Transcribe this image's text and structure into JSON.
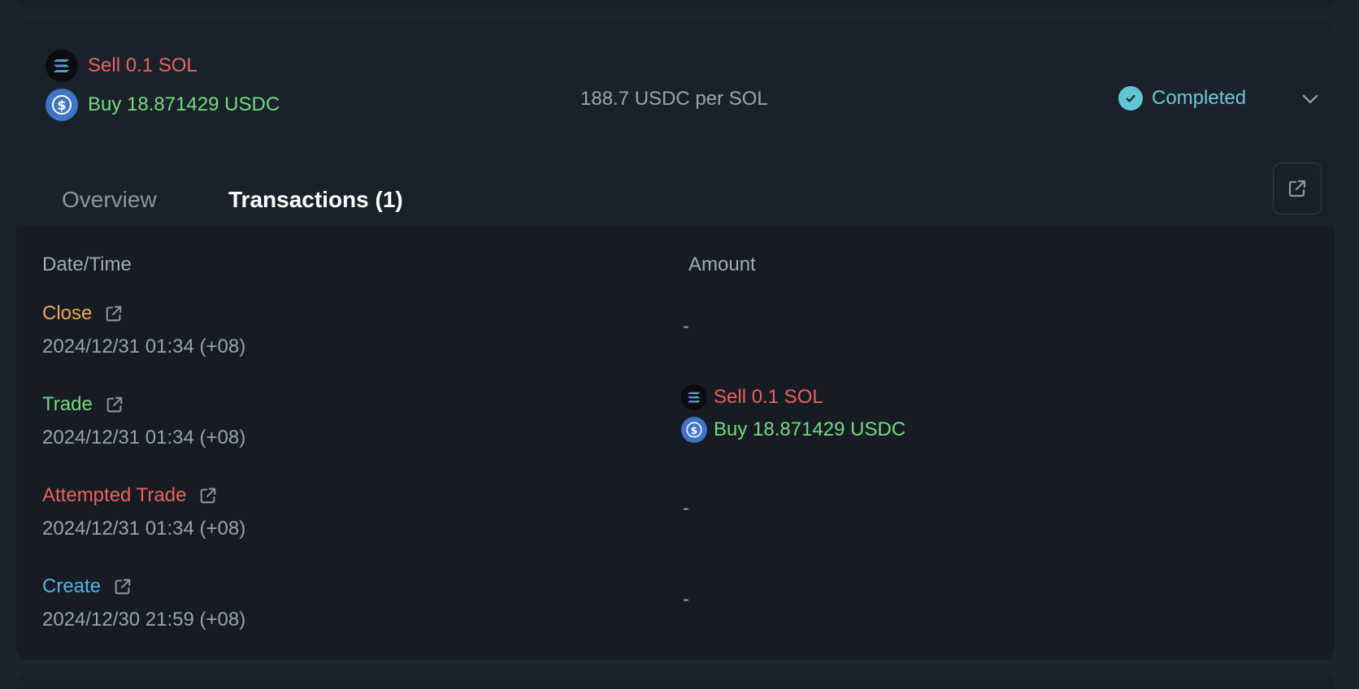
{
  "order": {
    "sell_label": "Sell 0.1 SOL",
    "buy_label": "Buy 18.871429 USDC",
    "rate": "188.7 USDC per SOL",
    "status": "Completed"
  },
  "tabs": [
    {
      "label": "Overview",
      "active": false
    },
    {
      "label": "Transactions (1)",
      "active": true
    }
  ],
  "table": {
    "headers": {
      "datetime": "Date/Time",
      "amount": "Amount"
    },
    "rows": [
      {
        "event": "Close",
        "event_color": "#f0a94e",
        "time": "2024/12/31 01:34 (+08)",
        "amount": "-"
      },
      {
        "event": "Trade",
        "event_color": "#72dc7e",
        "time": "2024/12/31 01:34 (+08)",
        "amount_sell": "Sell 0.1 SOL",
        "amount_buy": "Buy 18.871429 USDC"
      },
      {
        "event": "Attempted Trade",
        "event_color": "#e8625f",
        "time": "2024/12/31 01:34 (+08)",
        "amount": "-"
      },
      {
        "event": "Create",
        "event_color": "#4fb6e6",
        "time": "2024/12/30 21:59 (+08)",
        "amount": "-"
      }
    ]
  },
  "colors": {
    "sell": "#e8625f",
    "buy": "#72dc7e",
    "status": "#67c9d6",
    "tab_underline": "#c9f29a"
  },
  "icons": [
    "solana-icon",
    "usdc-icon",
    "check-circle-icon",
    "chevron-down-icon",
    "external-link-icon"
  ]
}
